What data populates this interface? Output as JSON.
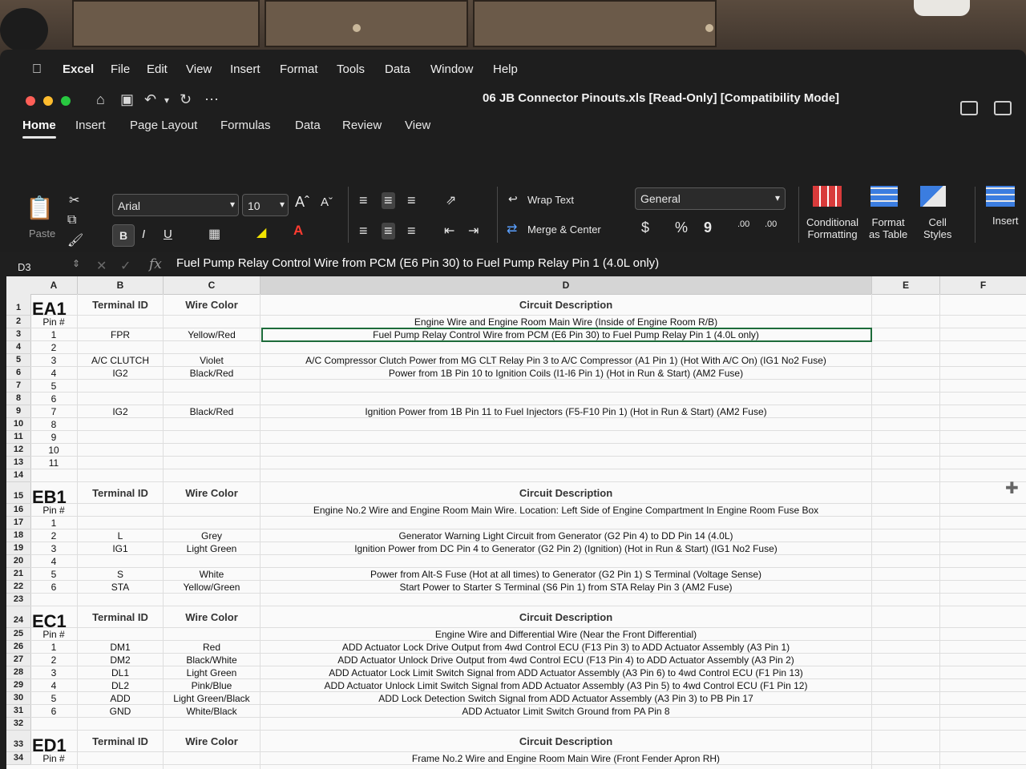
{
  "menubar": {
    "app": "Excel",
    "items": [
      "File",
      "Edit",
      "View",
      "Insert",
      "Format",
      "Tools",
      "Data",
      "Window",
      "Help"
    ]
  },
  "window": {
    "title": "06 JB Connector Pinouts.xls  [Read-Only]  [Compatibility Mode]"
  },
  "ribbon_tabs": [
    "Home",
    "Insert",
    "Page Layout",
    "Formulas",
    "Data",
    "Review",
    "View"
  ],
  "ribbon": {
    "paste": "Paste",
    "font": "Arial",
    "size": "10",
    "bold": "B",
    "italic": "I",
    "underline": "U",
    "wrap": "Wrap Text",
    "merge": "Merge & Center",
    "number_format": "General",
    "currency": "$",
    "percent": "%",
    "comma": "9",
    "inc_dec": ".00",
    "dec_dec": ".00",
    "cond_fmt": [
      "Conditional",
      "Formatting"
    ],
    "fmt_table": [
      "Format",
      "as Table"
    ],
    "cell_styles": [
      "Cell",
      "Styles"
    ],
    "insert": "Insert"
  },
  "formula_bar": {
    "name_box": "D3",
    "formula": "Fuel Pump Relay Control Wire from PCM (E6 Pin 30) to Fuel Pump Relay Pin 1 (4.0L only)"
  },
  "columns": [
    "A",
    "B",
    "C",
    "D",
    "E",
    "F"
  ],
  "rows": [
    {
      "n": "1",
      "a": "EA1",
      "b": "Terminal ID",
      "c": "Wire Color",
      "d": "Circuit Description",
      "h": true
    },
    {
      "n": "2",
      "a": "Pin #",
      "b": "",
      "c": "",
      "d": "Engine Wire and Engine Room Main Wire (Inside of Engine Room R/B)"
    },
    {
      "n": "3",
      "a": "1",
      "b": "FPR",
      "c": "Yellow/Red",
      "d": "Fuel Pump Relay Control Wire from PCM (E6 Pin 30) to Fuel Pump Relay Pin 1 (4.0L only)",
      "sel": true
    },
    {
      "n": "4",
      "a": "2",
      "b": "",
      "c": "",
      "d": ""
    },
    {
      "n": "5",
      "a": "3",
      "b": "A/C CLUTCH",
      "c": "Violet",
      "d": "A/C Compressor Clutch Power from MG CLT Relay Pin 3 to A/C Compressor (A1 Pin 1) (Hot With A/C On) (IG1 No2 Fuse)"
    },
    {
      "n": "6",
      "a": "4",
      "b": "IG2",
      "c": "Black/Red",
      "d": "Power from 1B Pin 10 to Ignition Coils (I1-I6 Pin 1) (Hot in Run & Start) (AM2 Fuse)"
    },
    {
      "n": "7",
      "a": "5",
      "b": "",
      "c": "",
      "d": ""
    },
    {
      "n": "8",
      "a": "6",
      "b": "",
      "c": "",
      "d": ""
    },
    {
      "n": "9",
      "a": "7",
      "b": "IG2",
      "c": "Black/Red",
      "d": "Ignition Power from 1B Pin 11 to Fuel Injectors (F5-F10 Pin 1) (Hot in Run & Start) (AM2 Fuse)"
    },
    {
      "n": "10",
      "a": "8",
      "b": "",
      "c": "",
      "d": ""
    },
    {
      "n": "11",
      "a": "9",
      "b": "",
      "c": "",
      "d": ""
    },
    {
      "n": "12",
      "a": "10",
      "b": "",
      "c": "",
      "d": ""
    },
    {
      "n": "13",
      "a": "11",
      "b": "",
      "c": "",
      "d": ""
    },
    {
      "n": "14",
      "a": "",
      "b": "",
      "c": "",
      "d": ""
    },
    {
      "n": "15",
      "a": "EB1",
      "b": "Terminal ID",
      "c": "Wire Color",
      "d": "Circuit Description",
      "h": true
    },
    {
      "n": "16",
      "a": "Pin #",
      "b": "",
      "c": "",
      "d": "Engine No.2 Wire and Engine Room Main Wire.  Location: Left Side of Engine Compartment In Engine Room Fuse Box"
    },
    {
      "n": "17",
      "a": "1",
      "b": "",
      "c": "",
      "d": ""
    },
    {
      "n": "18",
      "a": "2",
      "b": "L",
      "c": "Grey",
      "d": "Generator Warning Light Circuit from Generator (G2 Pin 4) to DD Pin 14 (4.0L)"
    },
    {
      "n": "19",
      "a": "3",
      "b": "IG1",
      "c": "Light Green",
      "d": "Ignition Power from DC Pin 4 to Generator (G2 Pin 2) (Ignition) (Hot in Run & Start) (IG1 No2 Fuse)"
    },
    {
      "n": "20",
      "a": "4",
      "b": "",
      "c": "",
      "d": ""
    },
    {
      "n": "21",
      "a": "5",
      "b": "S",
      "c": "White",
      "d": "Power from Alt-S Fuse (Hot at all times) to Generator (G2 Pin 1) S Terminal (Voltage Sense)"
    },
    {
      "n": "22",
      "a": "6",
      "b": "STA",
      "c": "Yellow/Green",
      "d": "Start Power to Starter S Terminal (S6 Pin 1) from STA Relay Pin 3 (AM2 Fuse)"
    },
    {
      "n": "23",
      "a": "",
      "b": "",
      "c": "",
      "d": ""
    },
    {
      "n": "24",
      "a": "EC1",
      "b": "Terminal ID",
      "c": "Wire Color",
      "d": "Circuit Description",
      "h": true
    },
    {
      "n": "25",
      "a": "Pin #",
      "b": "",
      "c": "",
      "d": "Engine Wire and Differential Wire (Near the Front Differential)"
    },
    {
      "n": "26",
      "a": "1",
      "b": "DM1",
      "c": "Red",
      "d": "ADD Actuator Lock Drive Output from 4wd Control ECU (F13 Pin 3) to ADD Actuator Assembly (A3 Pin 1)"
    },
    {
      "n": "27",
      "a": "2",
      "b": "DM2",
      "c": "Black/White",
      "d": "ADD Actuator Unlock Drive Output from 4wd Control ECU (F13 Pin 4) to ADD Actuator Assembly (A3 Pin 2)"
    },
    {
      "n": "28",
      "a": "3",
      "b": "DL1",
      "c": "Light Green",
      "d": "ADD Actuator Lock Limit Switch Signal from ADD Actuator Assembly (A3 Pin 6) to 4wd Control ECU (F1 Pin 13)"
    },
    {
      "n": "29",
      "a": "4",
      "b": "DL2",
      "c": "Pink/Blue",
      "d": "ADD Actuator Unlock Limit Switch Signal from ADD Actuator Assembly (A3 Pin 5) to 4wd Control ECU (F1 Pin 12)"
    },
    {
      "n": "30",
      "a": "5",
      "b": "ADD",
      "c": "Light Green/Black",
      "d": "ADD Lock Detection Switch Signal from ADD Actuator Assembly (A3 Pin 3) to PB Pin 17"
    },
    {
      "n": "31",
      "a": "6",
      "b": "GND",
      "c": "White/Black",
      "d": "ADD Actuator Limit Switch Ground from PA Pin 8"
    },
    {
      "n": "32",
      "a": "",
      "b": "",
      "c": "",
      "d": ""
    },
    {
      "n": "33",
      "a": "ED1",
      "b": "Terminal ID",
      "c": "Wire Color",
      "d": "Circuit Description",
      "h": true
    },
    {
      "n": "34",
      "a": "Pin #",
      "b": "",
      "c": "",
      "d": "Frame No.2 Wire and Engine Room Main Wire (Front Fender Apron RH)"
    }
  ]
}
